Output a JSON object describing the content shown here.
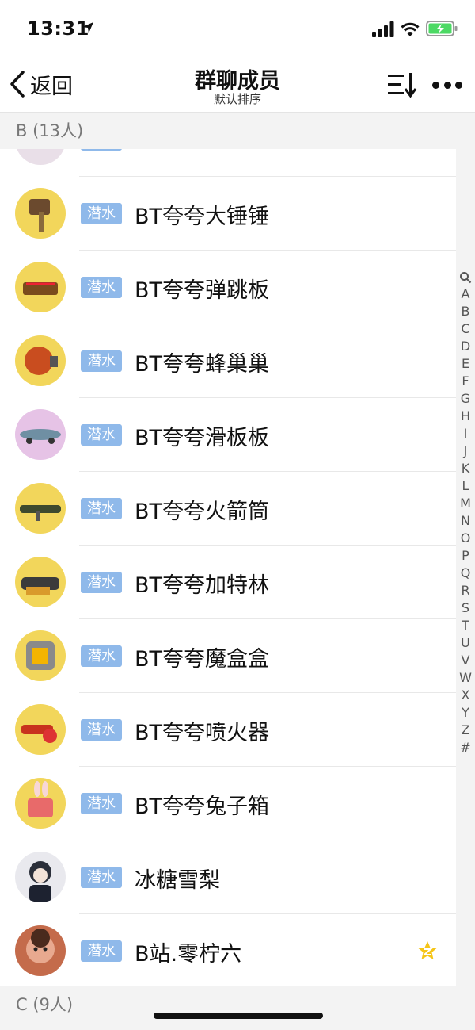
{
  "status": {
    "time": "13:31"
  },
  "nav": {
    "back_label": "返回",
    "title": "群聊成员",
    "subtitle": "默认排序"
  },
  "sections": {
    "b_header": "B (13人)",
    "c_header": "C (9人)"
  },
  "members": [
    {
      "tag": "潜水",
      "name": "BT夸夸大锤锤",
      "avatar": "hammer-avatar"
    },
    {
      "tag": "潜水",
      "name": "BT夸夸弹跳板",
      "avatar": "trampoline-avatar"
    },
    {
      "tag": "潜水",
      "name": "BT夸夸蜂巢巢",
      "avatar": "beehive-avatar"
    },
    {
      "tag": "潜水",
      "name": "BT夸夸滑板板",
      "avatar": "skateboard-avatar"
    },
    {
      "tag": "潜水",
      "name": "BT夸夸火箭筒",
      "avatar": "bazooka-avatar"
    },
    {
      "tag": "潜水",
      "name": "BT夸夸加特林",
      "avatar": "gatling-avatar"
    },
    {
      "tag": "潜水",
      "name": "BT夸夸魔盒盒",
      "avatar": "magic-box-avatar"
    },
    {
      "tag": "潜水",
      "name": "BT夸夸喷火器",
      "avatar": "flamethrower-avatar"
    },
    {
      "tag": "潜水",
      "name": "BT夸夸兔子箱",
      "avatar": "bunny-box-avatar"
    },
    {
      "tag": "潜水",
      "name": "冰糖雪梨",
      "avatar": "anime-girl-avatar"
    },
    {
      "tag": "潜水",
      "name": "B站.零柠六",
      "avatar": "child-photo-avatar",
      "badge": "star-badge-icon"
    }
  ],
  "index_letters": [
    "A",
    "B",
    "C",
    "D",
    "E",
    "F",
    "G",
    "H",
    "I",
    "J",
    "K",
    "L",
    "M",
    "N",
    "O",
    "P",
    "Q",
    "R",
    "S",
    "T",
    "U",
    "V",
    "W",
    "X",
    "Y",
    "Z",
    "#"
  ],
  "colors": {
    "tag_bg": "#8fb9ea",
    "avatar_bg": "#f2d65b",
    "battery_green": "#4cd964",
    "star": "#f5c518"
  }
}
